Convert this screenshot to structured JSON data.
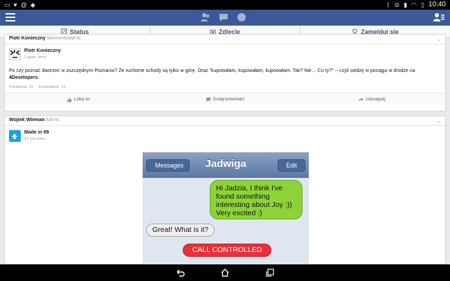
{
  "status_bar": {
    "left_icons": [
      "tv-icon",
      "twitter-icon",
      "at-icon",
      "dropbox-icon"
    ],
    "right_icons": [
      "bluetooth-icon",
      "mute-icon",
      "signal-icon",
      "wifi-icon",
      "battery-icon"
    ],
    "time": "10:40"
  },
  "composer": {
    "status_label": "Status",
    "photo_label": "Zdjęcie",
    "checkin_label": "Zamelduj się"
  },
  "post1": {
    "story_author": "Piotr Konieczny",
    "story_action": "skomentował to.",
    "author": "Piotr Konieczny",
    "meta": "1 godz. temu",
    "text": "Po czy poznać dworzec w oszczędnym Poznaniu? Że ruchome schody są tylko w górę. Oraz \"kupowałam, kupowałam, kupowałam. Tak? Nie… Co ty?\" -- czyli siedzę w pociągu w drodze na",
    "text_bold": "4Developers",
    "text_end": ".",
    "likes": "Polubienia: 14",
    "comments": "Komentarze: 14",
    "like_label": "Lubię to!",
    "comment_label": "Dodaj komentarz",
    "share_label": "Udostępnij"
  },
  "post2": {
    "story_author": "Wojtek Wieman",
    "story_action": "lubi to.",
    "author": "Made in 89",
    "meta": "37 min temu",
    "photo": {
      "back_label": "Messages",
      "title": "Jadwiga",
      "edit_label": "Edit",
      "msg_out": "Hi Jadzia, I think I've found something interesting about Joy :)) Very excited :)",
      "msg_in": "Great! What is it?",
      "call": "CALL CONTROLLED"
    }
  },
  "colors": {
    "fb_blue": "#3b5998",
    "imessage_green": "#8cd338",
    "call_red": "#e8313d"
  }
}
